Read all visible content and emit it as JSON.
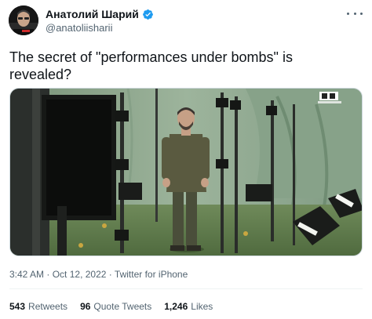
{
  "author": {
    "display_name": "Анатолий Шарий",
    "handle": "@anatoliisharii",
    "verified": true,
    "avatar_icon": "avatar-photo"
  },
  "tweet": {
    "text": "The secret of \"performances under bombs\" is revealed?"
  },
  "media": {
    "type": "video-still",
    "description_icon": "photo",
    "watermark": "QR"
  },
  "meta": {
    "time": "3:42 AM",
    "separator": "·",
    "date": "Oct 12, 2022",
    "source": "Twitter for iPhone"
  },
  "stats": {
    "retweets_count": "543",
    "retweets_label": "Retweets",
    "quotes_count": "96",
    "quotes_label": "Quote Tweets",
    "likes_count": "1,246",
    "likes_label": "Likes"
  },
  "colors": {
    "verified_blue": "#1d9bf0",
    "text_primary": "#0f1419",
    "text_secondary": "#536471",
    "green_screen": "#8ba890"
  }
}
